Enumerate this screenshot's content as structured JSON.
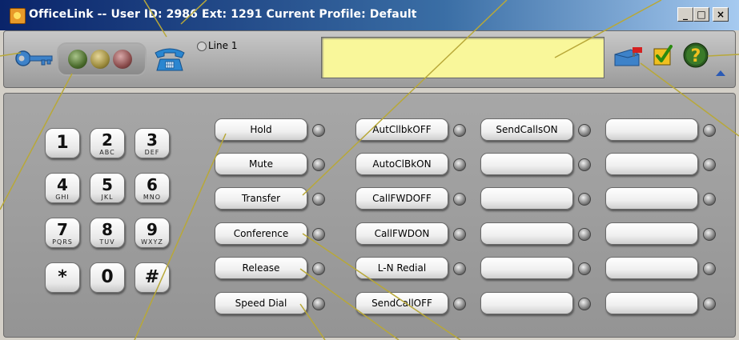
{
  "window": {
    "title": "OfficeLink -- User ID: 2986  Ext: 1291  Current Profile: Default",
    "controls": {
      "minimize": "_",
      "maximize": "□",
      "close": "×"
    }
  },
  "toolbar": {
    "line_label": "Line 1",
    "display_text": "",
    "icons": [
      "key-icon",
      "green-led",
      "yellow-led",
      "red-led",
      "phone-icon",
      "voicemail-icon",
      "check-icon",
      "help-icon"
    ]
  },
  "keypad": [
    {
      "num": "1",
      "letters": ""
    },
    {
      "num": "2",
      "letters": "ABC"
    },
    {
      "num": "3",
      "letters": "DEF"
    },
    {
      "num": "4",
      "letters": "GHI"
    },
    {
      "num": "5",
      "letters": "JKL"
    },
    {
      "num": "6",
      "letters": "MNO"
    },
    {
      "num": "7",
      "letters": "PQRS"
    },
    {
      "num": "8",
      "letters": "TUV"
    },
    {
      "num": "9",
      "letters": "WXYZ"
    },
    {
      "num": "*",
      "letters": ""
    },
    {
      "num": "0",
      "letters": ""
    },
    {
      "num": "#",
      "letters": ""
    }
  ],
  "function_columns": [
    [
      "Hold",
      "Mute",
      "Transfer",
      "Conference",
      "Release",
      "Speed Dial"
    ],
    [
      "AutCllbkOFF",
      "AutoClBkON",
      "CallFWDOFF",
      "CallFWDON",
      "L-N Redial",
      "SendCallOFF"
    ],
    [
      "SendCallsON",
      "",
      "",
      "",
      "",
      ""
    ],
    [
      "",
      "",
      "",
      "",
      "",
      ""
    ]
  ],
  "colors": {
    "title_bar": "#0a246a",
    "display": "#f9f79a",
    "panel": "#9d9d9d",
    "callout_line": "#b8a838"
  }
}
